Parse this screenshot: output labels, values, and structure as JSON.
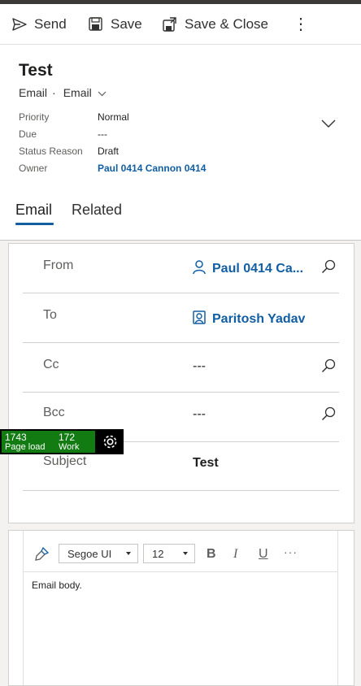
{
  "toolbar": {
    "send_label": "Send",
    "save_label": "Save",
    "save_close_label": "Save & Close",
    "more_label": "⋮"
  },
  "header": {
    "title": "Test",
    "entity": "Email",
    "separator": "·",
    "form_selector": "Email",
    "fields": [
      {
        "label": "Priority",
        "value": "Normal"
      },
      {
        "label": "Due",
        "value": "---"
      },
      {
        "label": "Status Reason",
        "value": "Draft"
      },
      {
        "label": "Owner",
        "value": "Paul 0414 Cannon 0414"
      }
    ]
  },
  "tabs": [
    {
      "label": "Email",
      "selected": true
    },
    {
      "label": "Related",
      "selected": false
    }
  ],
  "form": {
    "rows": [
      {
        "label": "From",
        "value": "Paul 0414 Ca...",
        "icon": "person-icon"
      },
      {
        "label": "To",
        "value": "Paritosh Yadav",
        "icon": "contact-card-icon"
      },
      {
        "label": "Cc",
        "value": "---"
      },
      {
        "label": "Bcc",
        "value": "---"
      },
      {
        "label": "Subject",
        "value": "Test"
      }
    ]
  },
  "editor": {
    "font": "Segoe UI",
    "size": "12",
    "bold": "B",
    "italic": "I",
    "underline": "U",
    "more": "···",
    "body": "Email body."
  },
  "perf": {
    "page_load_value": "1743",
    "page_load_label": "Page load",
    "work_value": "172",
    "work_label": "Work"
  },
  "colors": {
    "link": "#115ea3",
    "perf_green": "#127c12",
    "topbar": "#3b3a39"
  }
}
